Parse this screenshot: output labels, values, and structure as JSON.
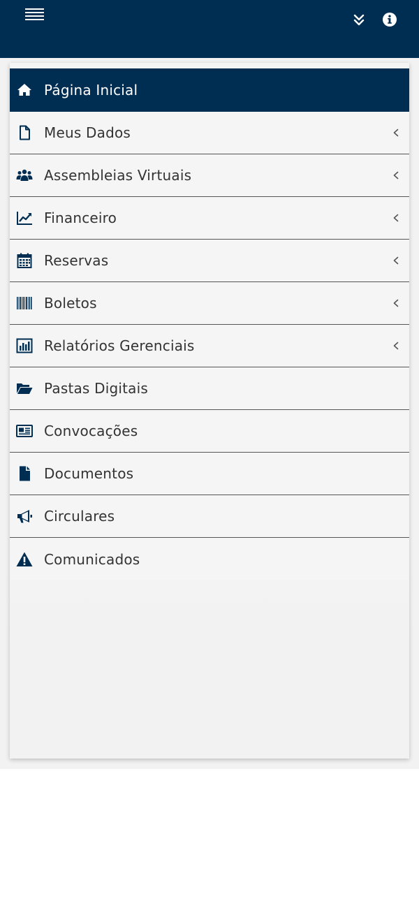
{
  "colors": {
    "header_bg": "#002d52",
    "active_bg": "#002d52",
    "icon_color": "#002d52",
    "text_color": "#333333",
    "panel_bg": "#f5f5f5"
  },
  "header": {
    "menu_icon": "hamburger-icon",
    "collapse_icon": "double-chevron-down-icon",
    "info_icon": "info-circle-icon"
  },
  "menu": {
    "items": [
      {
        "label": "Página Inicial",
        "icon": "home-icon",
        "active": true,
        "has_submenu": false
      },
      {
        "label": "Meus Dados",
        "icon": "file-icon",
        "active": false,
        "has_submenu": true
      },
      {
        "label": "Assembleias Virtuais",
        "icon": "users-icon",
        "active": false,
        "has_submenu": true
      },
      {
        "label": "Financeiro",
        "icon": "line-chart-icon",
        "active": false,
        "has_submenu": true
      },
      {
        "label": "Reservas",
        "icon": "calendar-icon",
        "active": false,
        "has_submenu": true
      },
      {
        "label": "Boletos",
        "icon": "barcode-icon",
        "active": false,
        "has_submenu": true
      },
      {
        "label": "Relatórios Gerenciais",
        "icon": "bar-chart-icon",
        "active": false,
        "has_submenu": true
      },
      {
        "label": "Pastas Digitais",
        "icon": "folder-open-icon",
        "active": false,
        "has_submenu": false
      },
      {
        "label": "Convocações",
        "icon": "newspaper-icon",
        "active": false,
        "has_submenu": false
      },
      {
        "label": "Documentos",
        "icon": "document-icon",
        "active": false,
        "has_submenu": false
      },
      {
        "label": "Circulares",
        "icon": "megaphone-icon",
        "active": false,
        "has_submenu": false
      },
      {
        "label": "Comunicados",
        "icon": "warning-icon",
        "active": false,
        "has_submenu": false
      }
    ]
  }
}
